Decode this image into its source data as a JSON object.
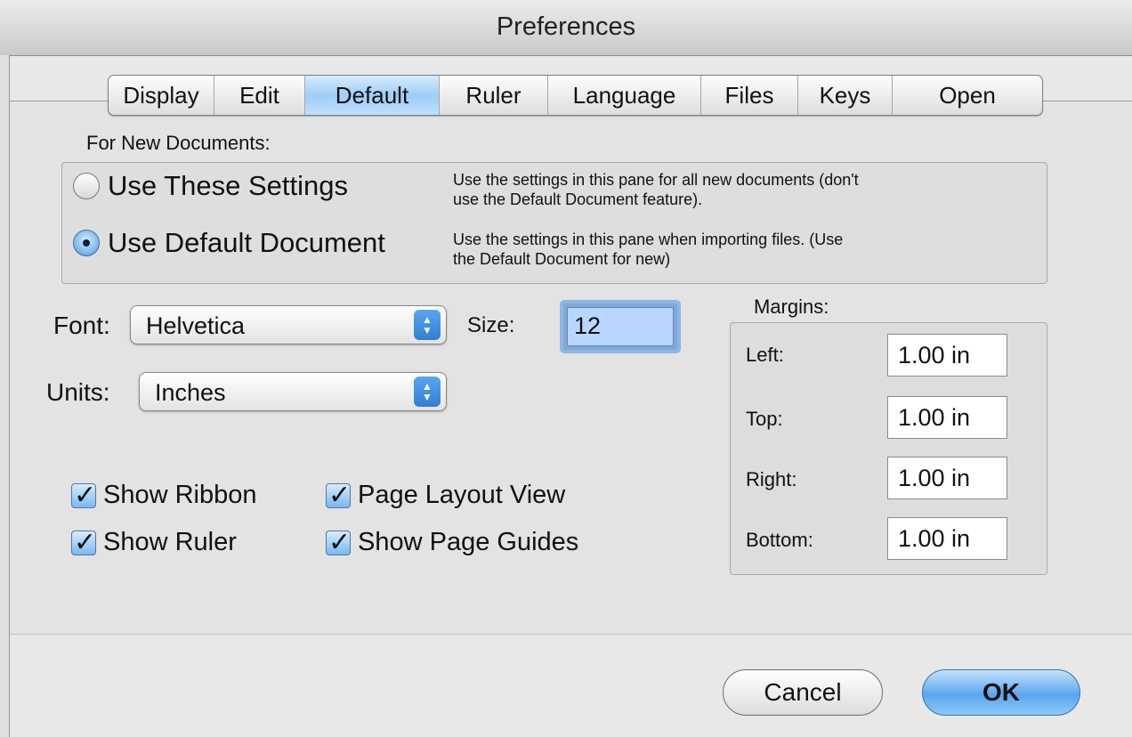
{
  "window": {
    "title": "Preferences"
  },
  "tabs": [
    {
      "label": "Display",
      "selected": false
    },
    {
      "label": "Edit",
      "selected": false
    },
    {
      "label": "Default",
      "selected": true
    },
    {
      "label": "Ruler",
      "selected": false
    },
    {
      "label": "Language",
      "selected": false
    },
    {
      "label": "Files",
      "selected": false
    },
    {
      "label": "Keys",
      "selected": false
    },
    {
      "label": "Open",
      "selected": false
    }
  ],
  "new_documents": {
    "label": "For New Documents:",
    "options": [
      {
        "label": "Use These Settings",
        "selected": false,
        "description_lines": [
          "Use the settings in this pane for all new documents (don't",
          "use the Default Document feature)."
        ]
      },
      {
        "label": "Use Default Document",
        "selected": true,
        "description_lines": [
          "Use the settings in this pane when importing files. (Use",
          "the Default Document for new)"
        ]
      }
    ]
  },
  "font": {
    "label": "Font:",
    "value": "Helvetica"
  },
  "size": {
    "label": "Size:",
    "value": "12"
  },
  "units": {
    "label": "Units:",
    "value": "Inches"
  },
  "checkboxes": [
    {
      "label": "Show Ribbon",
      "checked": true
    },
    {
      "label": "Page Layout View",
      "checked": true
    },
    {
      "label": "Show Ruler",
      "checked": true
    },
    {
      "label": "Show Page Guides",
      "checked": true
    }
  ],
  "margins": {
    "label": "Margins:",
    "left": {
      "label": "Left:",
      "value": "1.00 in"
    },
    "top": {
      "label": "Top:",
      "value": "1.00 in"
    },
    "right": {
      "label": "Right:",
      "value": "1.00 in"
    },
    "bottom": {
      "label": "Bottom:",
      "value": "1.00 in"
    }
  },
  "buttons": {
    "cancel": "Cancel",
    "ok": "OK"
  },
  "colors": {
    "accent": "#5aa6ef",
    "selection": "#b9d6ff"
  },
  "icons": {
    "popup_arrows": "up-down-arrows-icon",
    "check": "checkmark-icon"
  }
}
